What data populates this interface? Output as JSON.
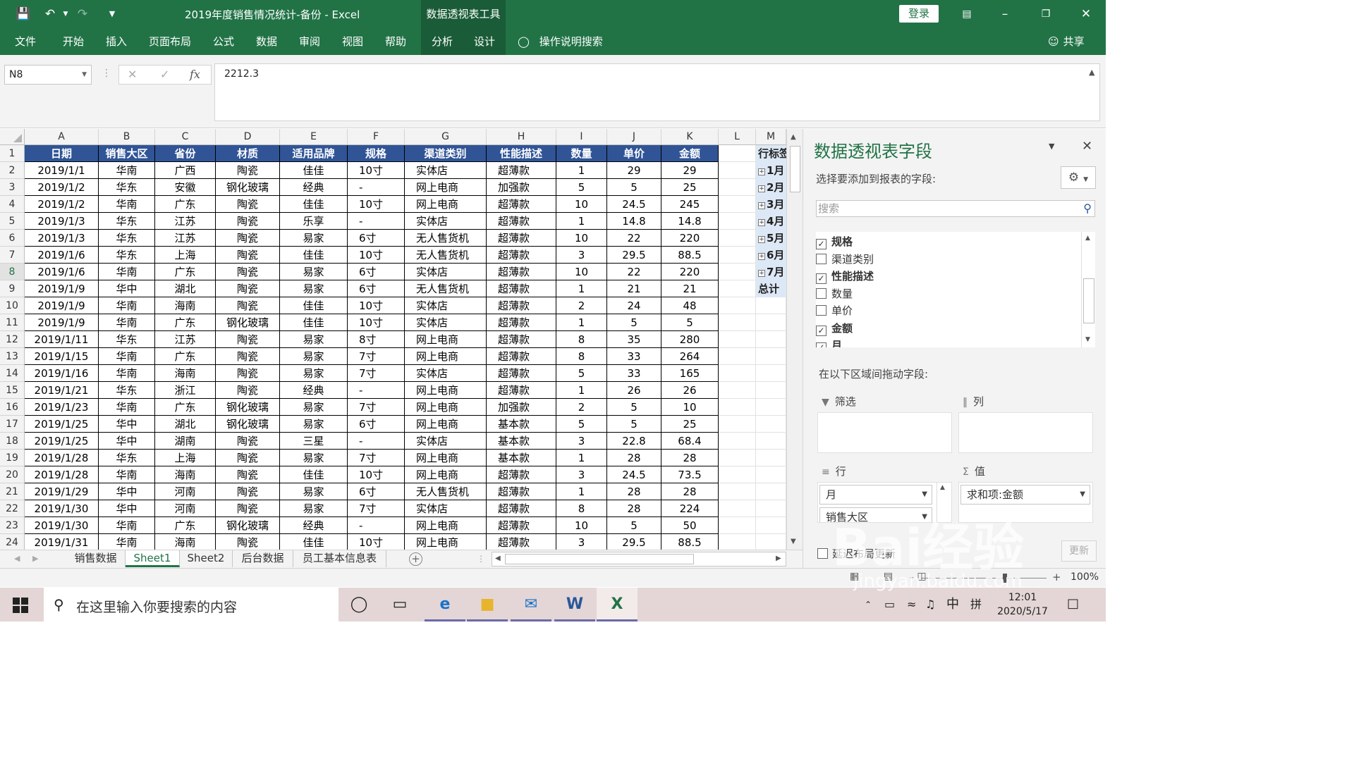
{
  "window": {
    "title": "2019年度销售情况统计-备份  -  Excel",
    "context_tool": "数据透视表工具",
    "login": "登录",
    "brand_color": "#217346"
  },
  "ribbon": {
    "tabs": [
      "文件",
      "开始",
      "插入",
      "页面布局",
      "公式",
      "数据",
      "审阅",
      "视图",
      "帮助",
      "分析",
      "设计"
    ],
    "tell_me": "操作说明搜索",
    "share": "共享"
  },
  "formula_bar": {
    "name_box": "N8",
    "value": "2212.3"
  },
  "columns": [
    "A",
    "B",
    "C",
    "D",
    "E",
    "F",
    "G",
    "H",
    "I",
    "J",
    "K",
    "L",
    "M"
  ],
  "table": {
    "header_color": "#305496",
    "headers": [
      "日期",
      "销售大区",
      "省份",
      "材质",
      "适用品牌",
      "规格",
      "渠道类别",
      "性能描述",
      "数量",
      "单价",
      "金额"
    ],
    "rows": [
      [
        "2019/1/1",
        "华南",
        "广西",
        "陶瓷",
        "佳佳",
        "10寸",
        "实体店",
        "超薄款",
        "1",
        "29",
        "29"
      ],
      [
        "2019/1/2",
        "华东",
        "安徽",
        "钢化玻璃",
        "经典",
        "-",
        "网上电商",
        "加强款",
        "5",
        "5",
        "25"
      ],
      [
        "2019/1/2",
        "华南",
        "广东",
        "陶瓷",
        "佳佳",
        "10寸",
        "网上电商",
        "超薄款",
        "10",
        "24.5",
        "245"
      ],
      [
        "2019/1/3",
        "华东",
        "江苏",
        "陶瓷",
        "乐享",
        "-",
        "实体店",
        "超薄款",
        "1",
        "14.8",
        "14.8"
      ],
      [
        "2019/1/3",
        "华东",
        "江苏",
        "陶瓷",
        "易家",
        "6寸",
        "无人售货机",
        "超薄款",
        "10",
        "22",
        "220"
      ],
      [
        "2019/1/6",
        "华东",
        "上海",
        "陶瓷",
        "佳佳",
        "10寸",
        "无人售货机",
        "超薄款",
        "3",
        "29.5",
        "88.5"
      ],
      [
        "2019/1/6",
        "华南",
        "广东",
        "陶瓷",
        "易家",
        "6寸",
        "实体店",
        "超薄款",
        "10",
        "22",
        "220"
      ],
      [
        "2019/1/9",
        "华中",
        "湖北",
        "陶瓷",
        "易家",
        "6寸",
        "无人售货机",
        "超薄款",
        "1",
        "21",
        "21"
      ],
      [
        "2019/1/9",
        "华南",
        "海南",
        "陶瓷",
        "佳佳",
        "10寸",
        "实体店",
        "超薄款",
        "2",
        "24",
        "48"
      ],
      [
        "2019/1/9",
        "华南",
        "广东",
        "钢化玻璃",
        "佳佳",
        "10寸",
        "实体店",
        "超薄款",
        "1",
        "5",
        "5"
      ],
      [
        "2019/1/11",
        "华东",
        "江苏",
        "陶瓷",
        "易家",
        "8寸",
        "网上电商",
        "超薄款",
        "8",
        "35",
        "280"
      ],
      [
        "2019/1/15",
        "华南",
        "广东",
        "陶瓷",
        "易家",
        "7寸",
        "网上电商",
        "超薄款",
        "8",
        "33",
        "264"
      ],
      [
        "2019/1/16",
        "华南",
        "海南",
        "陶瓷",
        "易家",
        "7寸",
        "实体店",
        "超薄款",
        "5",
        "33",
        "165"
      ],
      [
        "2019/1/21",
        "华东",
        "浙江",
        "陶瓷",
        "经典",
        "-",
        "网上电商",
        "超薄款",
        "1",
        "26",
        "26"
      ],
      [
        "2019/1/23",
        "华南",
        "广东",
        "钢化玻璃",
        "易家",
        "7寸",
        "网上电商",
        "加强款",
        "2",
        "5",
        "10"
      ],
      [
        "2019/1/25",
        "华中",
        "湖北",
        "钢化玻璃",
        "易家",
        "6寸",
        "网上电商",
        "基本款",
        "5",
        "5",
        "25"
      ],
      [
        "2019/1/25",
        "华中",
        "湖南",
        "陶瓷",
        "三星",
        "-",
        "实体店",
        "基本款",
        "3",
        "22.8",
        "68.4"
      ],
      [
        "2019/1/28",
        "华东",
        "上海",
        "陶瓷",
        "易家",
        "7寸",
        "网上电商",
        "基本款",
        "1",
        "28",
        "28"
      ],
      [
        "2019/1/28",
        "华南",
        "海南",
        "陶瓷",
        "佳佳",
        "10寸",
        "网上电商",
        "超薄款",
        "3",
        "24.5",
        "73.5"
      ],
      [
        "2019/1/29",
        "华中",
        "河南",
        "陶瓷",
        "易家",
        "6寸",
        "无人售货机",
        "超薄款",
        "1",
        "28",
        "28"
      ],
      [
        "2019/1/30",
        "华中",
        "河南",
        "陶瓷",
        "易家",
        "7寸",
        "实体店",
        "超薄款",
        "8",
        "28",
        "224"
      ],
      [
        "2019/1/30",
        "华南",
        "广东",
        "钢化玻璃",
        "经典",
        "-",
        "网上电商",
        "超薄款",
        "10",
        "5",
        "50"
      ],
      [
        "2019/1/31",
        "华南",
        "海南",
        "陶瓷",
        "佳佳",
        "10寸",
        "网上电商",
        "超薄款",
        "3",
        "29.5",
        "88.5"
      ]
    ]
  },
  "pivot_preview": {
    "header": "行标签",
    "rows": [
      "1月",
      "2月",
      "3月",
      "4月",
      "5月",
      "6月",
      "7月"
    ],
    "total": "总计"
  },
  "active_row": 8,
  "sheet_tabs": [
    "销售数据",
    "Sheet1",
    "Sheet2",
    "后台数据",
    "员工基本信息表"
  ],
  "active_sheet": "Sheet1",
  "status": {
    "zoom": "100%"
  },
  "pivot_pane": {
    "title": "数据透视表字段",
    "choose_label": "选择要添加到报表的字段:",
    "search_placeholder": "搜索",
    "fields": [
      {
        "name": "规格",
        "checked": true
      },
      {
        "name": "渠道类别",
        "checked": false
      },
      {
        "name": "性能描述",
        "checked": true
      },
      {
        "name": "数量",
        "checked": false
      },
      {
        "name": "单价",
        "checked": false
      },
      {
        "name": "金额",
        "checked": true
      },
      {
        "name": "月",
        "checked": true
      }
    ],
    "drag_label": "在以下区域间拖动字段:",
    "areas": {
      "filter": "筛选",
      "columns": "列",
      "rows": "行",
      "values": "值"
    },
    "row_fields": [
      "月",
      "销售大区"
    ],
    "value_fields": [
      "求和项:金额"
    ],
    "defer_label": "延迟布局更新",
    "update_label": "更新"
  },
  "taskbar": {
    "search_text": "在这里输入你要搜索的内容",
    "ime_lang": "中",
    "ime_mode": "拼",
    "time": "12:01",
    "date": "2020/5/17"
  },
  "watermark": {
    "logo": "Bai经验",
    "site": "jingyan.baidu.com"
  }
}
